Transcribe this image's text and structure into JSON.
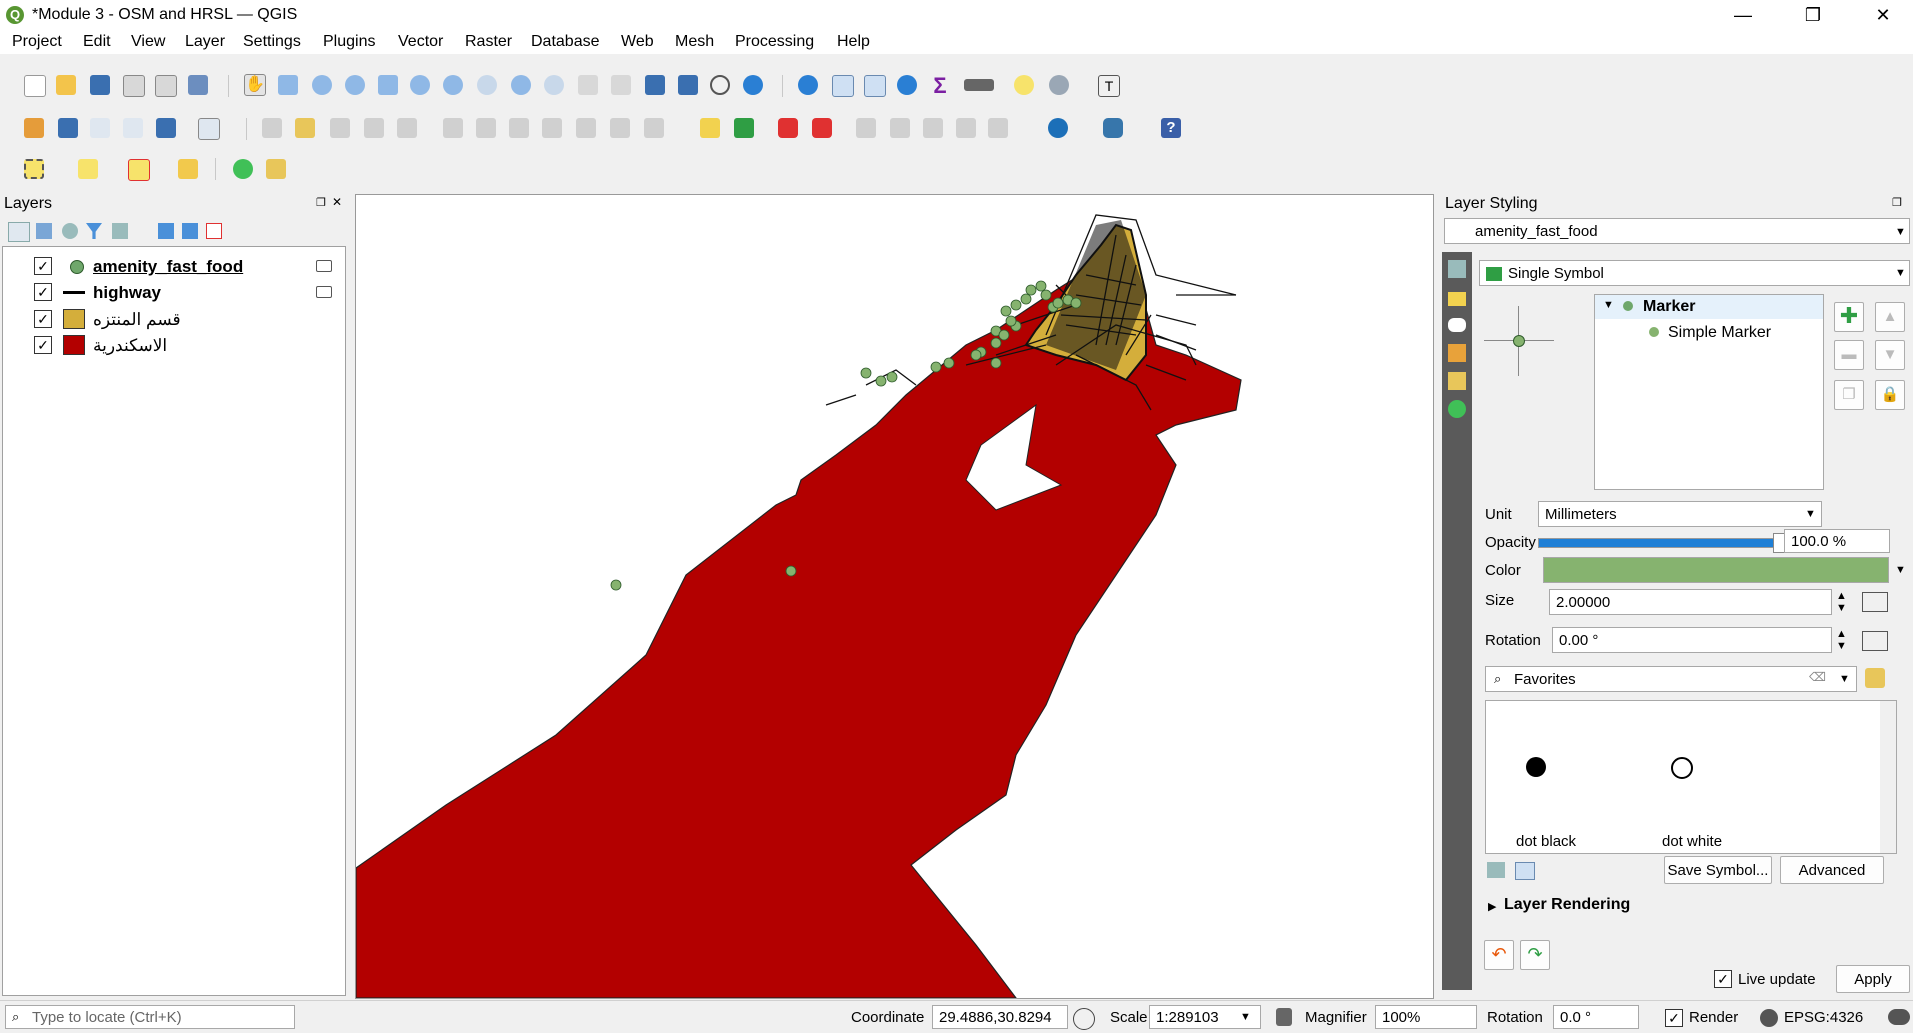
{
  "window": {
    "title": "*Module 3 - OSM and HRSL — QGIS",
    "minimize": "—",
    "restore": "❐",
    "close": "✕"
  },
  "menu": [
    "Project",
    "Edit",
    "View",
    "Layer",
    "Settings",
    "Plugins",
    "Vector",
    "Raster",
    "Database",
    "Web",
    "Mesh",
    "Processing",
    "Help"
  ],
  "layers_panel": {
    "title": "Layers",
    "layers": [
      {
        "name": "amenity_fast_food",
        "checked": true,
        "symbol": "point",
        "color": "#6fa76b"
      },
      {
        "name": "highway",
        "checked": true,
        "symbol": "line",
        "color": "#000000"
      },
      {
        "name": "قسم المنتزه",
        "checked": true,
        "symbol": "fill",
        "color": "#d4ae3b"
      },
      {
        "name": "الاسكندرية",
        "checked": true,
        "symbol": "fill",
        "color": "#b30000"
      }
    ]
  },
  "map": {
    "polygon_color": "#b30000",
    "district_color": "#d4ae3b",
    "point_color": "#86b36f"
  },
  "styling_panel": {
    "title": "Layer Styling",
    "layer_select": "amenity_fast_food",
    "renderer": "Single Symbol",
    "tree": {
      "root": "Marker",
      "child": "Simple Marker"
    },
    "unit_label": "Unit",
    "unit_value": "Millimeters",
    "opacity_label": "Opacity",
    "opacity_value": "100.0 %",
    "opacity_fraction": 1.0,
    "color_label": "Color",
    "color_value": "#86b36f",
    "size_label": "Size",
    "size_value": "2.00000",
    "rotation_label": "Rotation",
    "rotation_value": "0.00 °",
    "search_value": "Favorites",
    "symbols": [
      "dot  black",
      "dot  white"
    ],
    "save_symbol": "Save Symbol...",
    "advanced": "Advanced",
    "layer_rendering": "Layer Rendering",
    "live_update": "Live update",
    "apply": "Apply"
  },
  "statusbar": {
    "locator_placeholder": "Type to locate (Ctrl+K)",
    "coordinate_label": "Coordinate",
    "coordinate_value": "29.4886,30.8294",
    "scale_label": "Scale",
    "scale_value": "1:289103",
    "magnifier_label": "Magnifier",
    "magnifier_value": "100%",
    "rotation_label": "Rotation",
    "rotation_value": "0.0 °",
    "render_label": "Render",
    "crs": "EPSG:4326"
  }
}
